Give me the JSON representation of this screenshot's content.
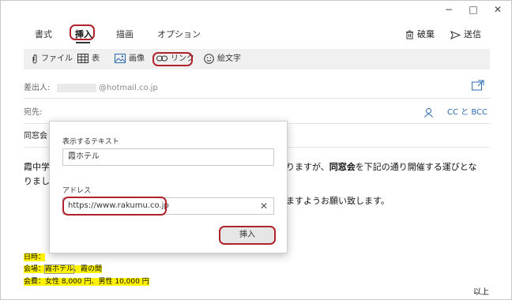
{
  "window": {
    "minimize": "−",
    "maximize": "□",
    "close": "✕"
  },
  "tabs": [
    {
      "label": "書式",
      "active": false
    },
    {
      "label": "挿入",
      "active": true
    },
    {
      "label": "描画",
      "active": false
    },
    {
      "label": "オプション",
      "active": false
    }
  ],
  "actions": {
    "discard_label": "破棄",
    "send_label": "送信"
  },
  "ribbon": {
    "file_label": "ファイル",
    "table_label": "表",
    "image_label": "画像",
    "link_label": "リンク",
    "emoji_label": "絵文字"
  },
  "header": {
    "from_label": "差出人:",
    "from_value": "@hotmail.co.jp",
    "to_label": "宛先:",
    "cc_label": "CC と BCC",
    "subject_value": "同窓会"
  },
  "body": {
    "line1_prefix": "霞中学",
    "line1_mid": "りますが、",
    "line1_bold": "同窓会",
    "line1_suffix": "を下記の通り開催する運びとな",
    "line2": "りまし",
    "line3": "ますようお願い致します。",
    "date_line": "日時：",
    "venue_prefix": "会場：",
    "venue_name": "霞ホテル",
    "venue_suffix": "、霞の間",
    "fee_line": "会費：女性 8,000 円、男性 10,000 円",
    "closing": "以上"
  },
  "dialog": {
    "display_text_label": "表示するテキスト",
    "display_text_value": "霞ホテル",
    "address_label": "アドレス",
    "address_value": "https://www.rakumu.co.jp",
    "clear_icon": "✕",
    "insert_label": "挿入"
  },
  "colors": {
    "highlight": "#fff200",
    "annotation": "#b0232a",
    "accent": "#2b6cb0"
  }
}
